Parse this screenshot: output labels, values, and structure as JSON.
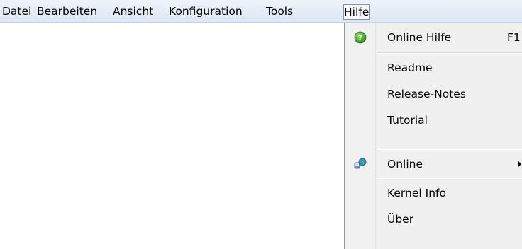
{
  "menubar": {
    "items": [
      {
        "label": "Datei"
      },
      {
        "label": "Bearbeiten"
      },
      {
        "label": "Ansicht"
      },
      {
        "label": "Konfiguration"
      },
      {
        "label": "Tools"
      },
      {
        "label": "Hilfe",
        "active": true
      }
    ]
  },
  "help_menu": {
    "items": [
      {
        "label": "Online Hilfe",
        "shortcut": "F1",
        "icon": "help-icon"
      },
      {
        "label": "Readme"
      },
      {
        "label": "Release-Notes"
      },
      {
        "label": "Tutorial"
      },
      {
        "label": "Online",
        "icon": "network-globe-icon",
        "submenu": true
      },
      {
        "label": "Kernel Info"
      },
      {
        "label": "Über"
      }
    ]
  },
  "colors": {
    "menubar_bg": "#e4ecf7",
    "dropdown_bg": "#f0f0f0",
    "help_icon_green": "#3fae2a"
  }
}
